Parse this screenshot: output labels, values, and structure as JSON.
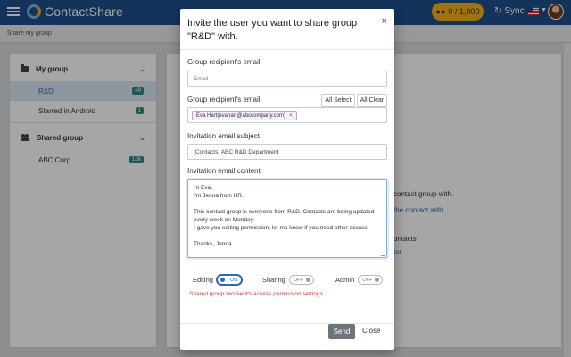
{
  "topbar": {
    "brand": "ContactShare",
    "counter": "0 / 1,000",
    "sync_label": "Sync"
  },
  "breadcrumb": "Share my group",
  "sidebar": {
    "my_group_label": "My group",
    "my_group_items": [
      {
        "label": "R&D",
        "count": "49",
        "active": true
      },
      {
        "label": "Starred in Android",
        "count": "1",
        "active": false
      }
    ],
    "shared_group_label": "Shared group",
    "shared_group_items": [
      {
        "label": "ABC Corp",
        "count": "136"
      }
    ]
  },
  "background_main": {
    "line1": "contact group with.",
    "line2": "the contact with.",
    "line3": "ontacts",
    "line4": "tor"
  },
  "modal": {
    "title": "Invite the user you want to share group \"R&D\" with.",
    "email_label_1": "Group recipient's email",
    "email_placeholder": "Email",
    "email_label_2": "Group recipient's email",
    "all_select": "All Select",
    "all_clear": "All Clear",
    "recipient_chip": "Eva Hart(evahart@abccompany.com)",
    "subject_label": "Invitation email subject",
    "subject_value": "[Contacts] ABC R&D Department",
    "content_label": "Invitation email content",
    "content_lines": {
      "l1": "Hi Eva,",
      "l2": "I'm Jenna from HR.",
      "l3": "This contact group is everyone from R&D. Contacts are being updated",
      "l4": "every week on Monday.",
      "l5": "I gave you editing permission, let me know if you need other access.",
      "l6": "Thanks, Jenna"
    },
    "permissions": {
      "editing_label": "Editing",
      "editing_state": "ON",
      "sharing_label": "Sharing",
      "sharing_state": "OFF",
      "admin_label": "Admin",
      "admin_state": "OFF"
    },
    "permission_note": "Shared group recipient's access permission settings.",
    "send_label": "Send",
    "close_label": "Close"
  },
  "colors": {
    "topbar": "#1f4f8a",
    "accent": "#2a6bb3",
    "counter_pill": "#f4b31a",
    "warning_text": "#d23c3c"
  }
}
